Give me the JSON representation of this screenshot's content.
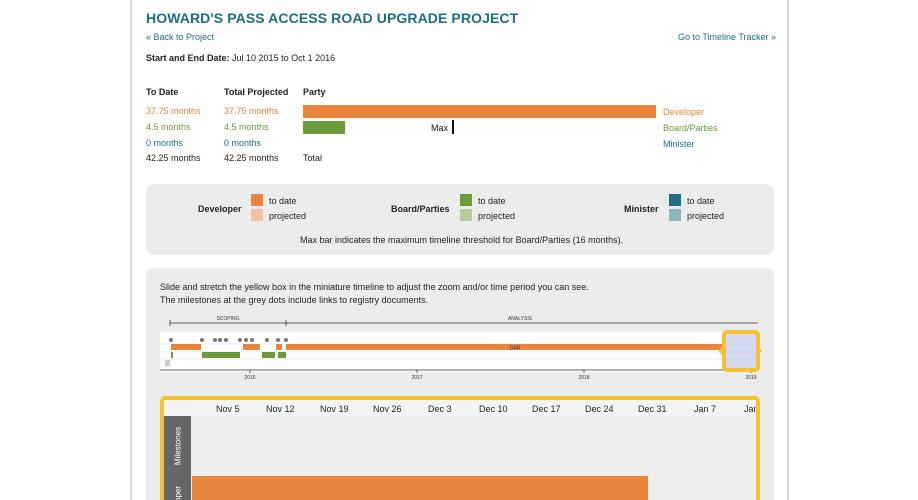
{
  "header": {
    "title": "HOWARD'S PASS ACCESS ROAD UPGRADE PROJECT",
    "back_link": "« Back to Project",
    "tracker_link": "Go to Timeline Tracker »",
    "dates_label": "Start and End Date:",
    "dates_value": "Jul 10 2015 to Oct 1 2016"
  },
  "summary": {
    "headers": {
      "to_date": "To Date",
      "total": "Total Projected",
      "party": "Party"
    },
    "rows": [
      {
        "to_date": "37.75 months",
        "total": "37.75 months",
        "party": "Developer",
        "color": "#e8843c",
        "bar_fraction": 1.0
      },
      {
        "to_date": "4.5 months",
        "total": "4.5 months",
        "party": "Board/Parties",
        "color": "#6d9a3a",
        "bar_fraction": 0.119
      },
      {
        "to_date": "0 months",
        "total": "0 months",
        "party": "Minister",
        "color": "#1d6e82",
        "bar_fraction": 0
      }
    ],
    "total_row": {
      "to_date": "42.25 months",
      "total": "42.25 months",
      "label": "Total"
    },
    "max_label": "Max"
  },
  "legend": {
    "groups": [
      {
        "name": "Developer",
        "to_date_color": "#e8843c",
        "projected_color": "#f2c2a0"
      },
      {
        "name": "Board/Parties",
        "to_date_color": "#6d9a3a",
        "projected_color": "#b5cc9c"
      },
      {
        "name": "Minister",
        "to_date_color": "#1d6e82",
        "projected_color": "#8fb5be"
      }
    ],
    "to_date_label": "to date",
    "projected_label": "projected",
    "note": "Max bar indicates the maximum timeline threshold for Board/Parties (16 months)."
  },
  "timeline": {
    "instructions_1": "Slide and stretch the yellow box in the miniature timeline to adjust the zoom and/or time period you can see.",
    "instructions_2": "The milestones at the grey dots include links to registry documents.",
    "phases": {
      "scoping": "SCOPING",
      "analysis": "ANALYSIS"
    },
    "bar_label": "DAR",
    "years": [
      "2016",
      "2017",
      "2018",
      "2019"
    ],
    "zoom_dates": [
      "Nov 5",
      "Nov 12",
      "Nov 19",
      "Nov 26",
      "Dec 3",
      "Dec 10",
      "Dec 17",
      "Dec 24",
      "Dec 31",
      "Jan 7",
      "Jan"
    ],
    "row_labels": {
      "milestones": "Milestones",
      "developer": "oper"
    }
  }
}
